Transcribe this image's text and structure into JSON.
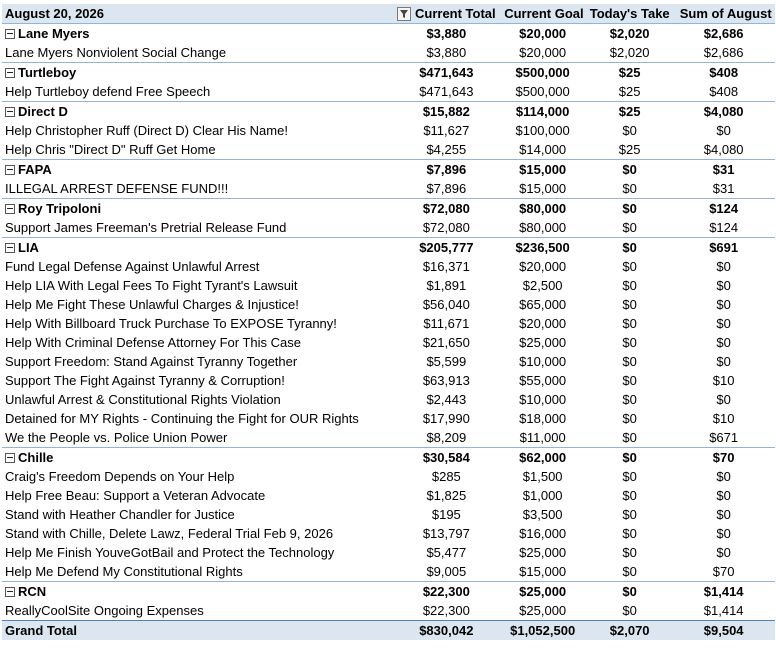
{
  "header": {
    "date": "August 20, 2026",
    "col_total": "Current Total",
    "col_goal": "Current Goal",
    "col_today": "Today's Take",
    "col_aug": "Sum of August",
    "filter_icon": "filter-dropdown-icon"
  },
  "groups": [
    {
      "name": "Lane Myers",
      "total": "$3,880",
      "goal": "$20,000",
      "today": "$2,020",
      "aug": "$2,686",
      "items": [
        {
          "name": "Lane Myers Nonviolent Social Change",
          "total": "$3,880",
          "goal": "$20,000",
          "today": "$2,020",
          "aug": "$2,686"
        }
      ]
    },
    {
      "name": "Turtleboy",
      "total": "$471,643",
      "goal": "$500,000",
      "today": "$25",
      "aug": "$408",
      "items": [
        {
          "name": "Help Turtleboy defend Free Speech",
          "total": "$471,643",
          "goal": "$500,000",
          "today": "$25",
          "aug": "$408"
        }
      ]
    },
    {
      "name": "Direct D",
      "total": "$15,882",
      "goal": "$114,000",
      "today": "$25",
      "aug": "$4,080",
      "items": [
        {
          "name": "Help Christopher Ruff (Direct D) Clear His Name!",
          "total": "$11,627",
          "goal": "$100,000",
          "today": "$0",
          "aug": "$0"
        },
        {
          "name": "Help Chris \"Direct D\" Ruff Get Home",
          "total": "$4,255",
          "goal": "$14,000",
          "today": "$25",
          "aug": "$4,080"
        }
      ]
    },
    {
      "name": "FAPA",
      "total": "$7,896",
      "goal": "$15,000",
      "today": "$0",
      "aug": "$31",
      "items": [
        {
          "name": "ILLEGAL ARREST DEFENSE FUND!!!",
          "total": "$7,896",
          "goal": "$15,000",
          "today": "$0",
          "aug": "$31"
        }
      ]
    },
    {
      "name": "Roy Tripoloni",
      "total": "$72,080",
      "goal": "$80,000",
      "today": "$0",
      "aug": "$124",
      "items": [
        {
          "name": "Support James Freeman's Pretrial Release Fund",
          "total": "$72,080",
          "goal": "$80,000",
          "today": "$0",
          "aug": "$124"
        }
      ]
    },
    {
      "name": "LIA",
      "total": "$205,777",
      "goal": "$236,500",
      "today": "$0",
      "aug": "$691",
      "items": [
        {
          "name": "Fund Legal Defense Against Unlawful Arrest",
          "total": "$16,371",
          "goal": "$20,000",
          "today": "$0",
          "aug": "$0"
        },
        {
          "name": "Help LIA With Legal Fees To Fight Tyrant's Lawsuit",
          "total": "$1,891",
          "goal": "$2,500",
          "today": "$0",
          "aug": "$0"
        },
        {
          "name": "Help Me Fight These Unlawful Charges & Injustice!",
          "total": "$56,040",
          "goal": "$65,000",
          "today": "$0",
          "aug": "$0"
        },
        {
          "name": "Help With Billboard Truck Purchase To EXPOSE Tyranny!",
          "total": "$11,671",
          "goal": "$20,000",
          "today": "$0",
          "aug": "$0"
        },
        {
          "name": "Help With Criminal Defense Attorney For This Case",
          "total": "$21,650",
          "goal": "$25,000",
          "today": "$0",
          "aug": "$0"
        },
        {
          "name": "Support Freedom: Stand Against Tyranny Together",
          "total": "$5,599",
          "goal": "$10,000",
          "today": "$0",
          "aug": "$0"
        },
        {
          "name": "Support The Fight Against Tyranny & Corruption!",
          "total": "$63,913",
          "goal": "$55,000",
          "today": "$0",
          "aug": "$10"
        },
        {
          "name": "Unlawful Arrest & Constitutional Rights Violation",
          "total": "$2,443",
          "goal": "$10,000",
          "today": "$0",
          "aug": "$0"
        },
        {
          "name": "Detained for MY Rights - Continuing the Fight for OUR Rights",
          "total": "$17,990",
          "goal": "$18,000",
          "today": "$0",
          "aug": "$10"
        },
        {
          "name": "We the People vs. Police Union Power",
          "total": "$8,209",
          "goal": "$11,000",
          "today": "$0",
          "aug": "$671"
        }
      ]
    },
    {
      "name": "Chille",
      "total": "$30,584",
      "goal": "$62,000",
      "today": "$0",
      "aug": "$70",
      "items": [
        {
          "name": "Craig's Freedom Depends on Your Help",
          "total": "$285",
          "goal": "$1,500",
          "today": "$0",
          "aug": "$0"
        },
        {
          "name": "Help Free Beau: Support a Veteran Advocate",
          "total": "$1,825",
          "goal": "$1,000",
          "today": "$0",
          "aug": "$0"
        },
        {
          "name": "Stand with Heather Chandler for Justice",
          "total": "$195",
          "goal": "$3,500",
          "today": "$0",
          "aug": "$0"
        },
        {
          "name": "Stand with Chille, Delete Lawz, Federal Trial Feb 9, 2026",
          "total": "$13,797",
          "goal": "$16,000",
          "today": "$0",
          "aug": "$0"
        },
        {
          "name": "Help Me Finish YouveGotBail and Protect the Technology",
          "total": "$5,477",
          "goal": "$25,000",
          "today": "$0",
          "aug": "$0"
        },
        {
          "name": "Help Me Defend My Constitutional Rights",
          "total": "$9,005",
          "goal": "$15,000",
          "today": "$0",
          "aug": "$70"
        }
      ]
    },
    {
      "name": "RCN",
      "total": "$22,300",
      "goal": "$25,000",
      "today": "$0",
      "aug": "$1,414",
      "items": [
        {
          "name": "ReallyCoolSite Ongoing Expenses",
          "total": "$22,300",
          "goal": "$25,000",
          "today": "$0",
          "aug": "$1,414"
        }
      ]
    }
  ],
  "grand_total": {
    "label": "Grand Total",
    "total": "$830,042",
    "goal": "$1,052,500",
    "today": "$2,070",
    "aug": "$9,504"
  }
}
